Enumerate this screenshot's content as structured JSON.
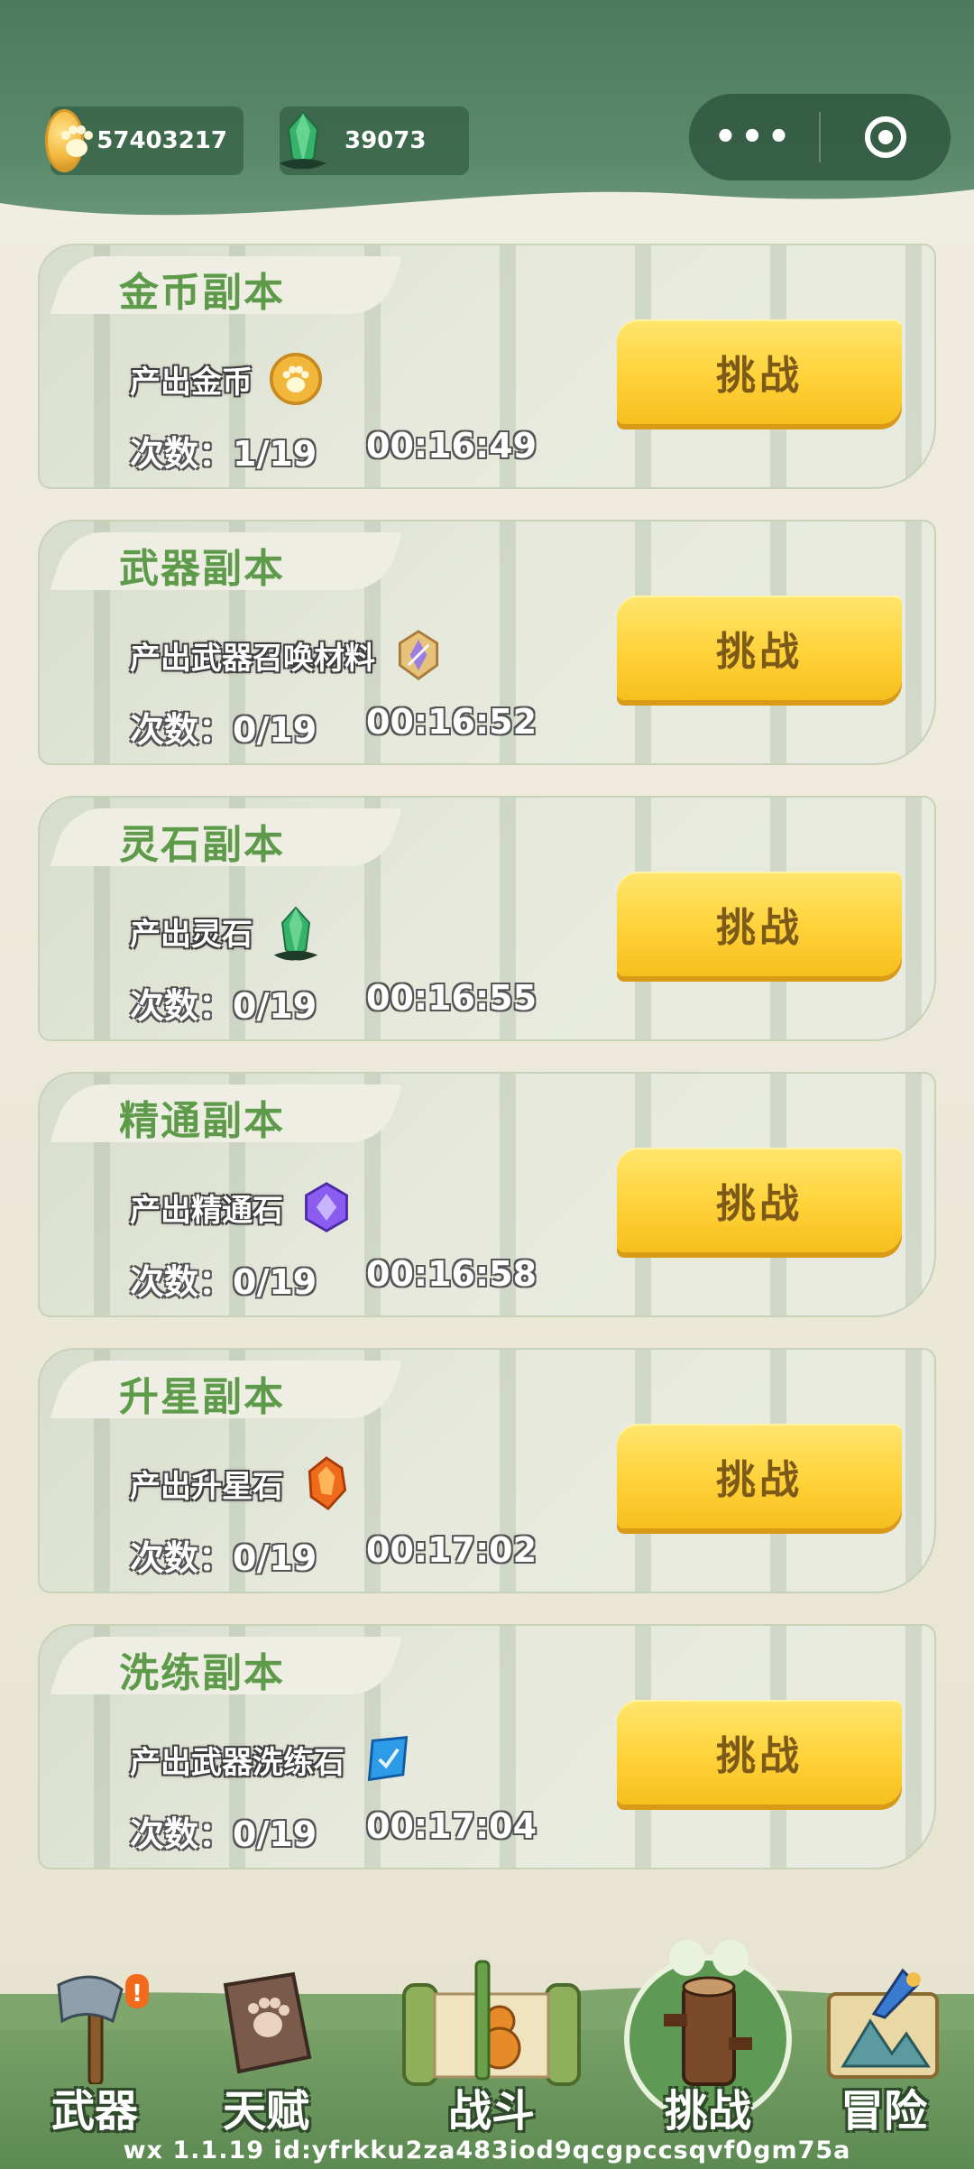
{
  "header": {
    "coins": "57403217",
    "spirit_stones": "39073",
    "menu_icon": "more-dots-icon",
    "close_icon": "target-icon"
  },
  "dungeons": [
    {
      "title": "金币副本",
      "produce": "产出金币",
      "icon": "coin-icon",
      "count": "次数：1/19",
      "timer": "00:16:49",
      "button": "挑战"
    },
    {
      "title": "武器副本",
      "produce": "产出武器召唤材料",
      "icon": "weapon-material-icon",
      "count": "次数：0/19",
      "timer": "00:16:52",
      "button": "挑战"
    },
    {
      "title": "灵石副本",
      "produce": "产出灵石",
      "icon": "spirit-stone-icon",
      "count": "次数：0/19",
      "timer": "00:16:55",
      "button": "挑战"
    },
    {
      "title": "精通副本",
      "produce": "产出精通石",
      "icon": "mastery-stone-icon",
      "count": "次数：0/19",
      "timer": "00:16:58",
      "button": "挑战"
    },
    {
      "title": "升星副本",
      "produce": "产出升星石",
      "icon": "star-stone-icon",
      "count": "次数：0/19",
      "timer": "00:17:02",
      "button": "挑战"
    },
    {
      "title": "洗练副本",
      "produce": "产出武器洗练石",
      "icon": "refine-stone-icon",
      "count": "次数：0/19",
      "timer": "00:17:04",
      "button": "挑战"
    }
  ],
  "nav": [
    {
      "label": "武器",
      "icon": "axe-icon"
    },
    {
      "label": "天赋",
      "icon": "talent-book-icon"
    },
    {
      "label": "战斗",
      "icon": "battle-scroll-icon"
    },
    {
      "label": "挑战",
      "icon": "challenge-stump-icon",
      "active": true
    },
    {
      "label": "冒险",
      "icon": "adventure-map-icon"
    }
  ],
  "footer": {
    "version": "wx  1.1.19 id:yfrkku2za483iod9qcgpccsqvf0gm75a"
  },
  "colors": {
    "header_green": "#5b8a6a",
    "title_green": "#5d9a4a",
    "button_yellow": "#ffd239",
    "button_text": "#7d5a18"
  }
}
